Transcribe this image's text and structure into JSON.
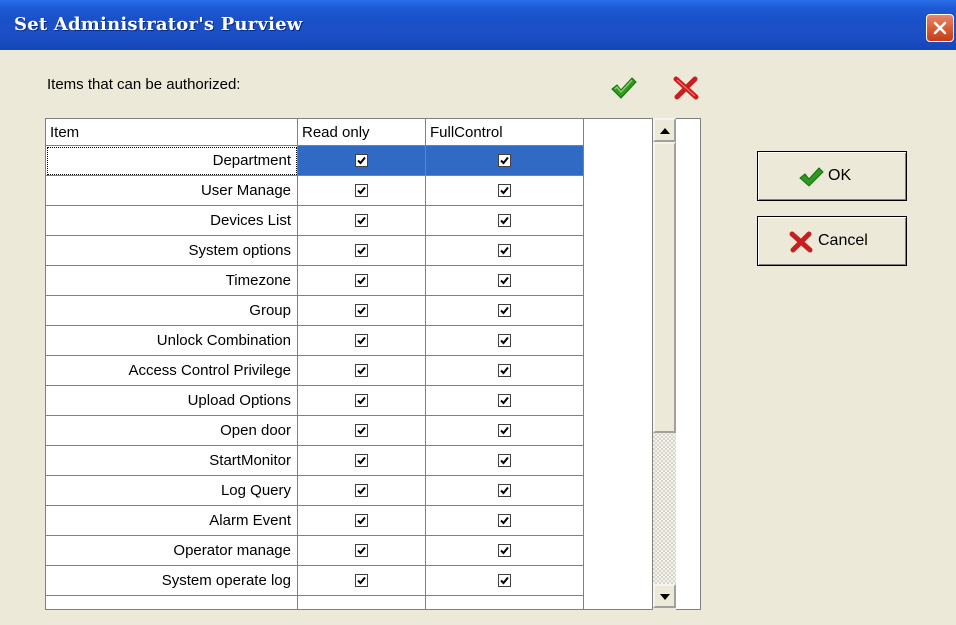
{
  "window": {
    "title": "Set Administrator's Purview"
  },
  "label": "Items that can be authorized:",
  "table": {
    "columns": [
      "Item",
      "Read only",
      "FullControl"
    ],
    "rows": [
      {
        "item": "Department",
        "read_only": true,
        "full_control": true
      },
      {
        "item": "User Manage",
        "read_only": true,
        "full_control": true
      },
      {
        "item": "Devices List",
        "read_only": true,
        "full_control": true
      },
      {
        "item": "System options",
        "read_only": true,
        "full_control": true
      },
      {
        "item": "Timezone",
        "read_only": true,
        "full_control": true
      },
      {
        "item": "Group",
        "read_only": true,
        "full_control": true
      },
      {
        "item": "Unlock Combination",
        "read_only": true,
        "full_control": true
      },
      {
        "item": "Access Control Privilege",
        "read_only": true,
        "full_control": true
      },
      {
        "item": "Upload Options",
        "read_only": true,
        "full_control": true
      },
      {
        "item": "Open door",
        "read_only": true,
        "full_control": true
      },
      {
        "item": "StartMonitor",
        "read_only": true,
        "full_control": true
      },
      {
        "item": "Log Query",
        "read_only": true,
        "full_control": true
      },
      {
        "item": "Alarm Event",
        "read_only": true,
        "full_control": true
      },
      {
        "item": "Operator manage",
        "read_only": true,
        "full_control": true
      },
      {
        "item": "System operate log",
        "read_only": true,
        "full_control": true
      }
    ],
    "selected_row": "Department"
  },
  "toolbar": {
    "check_all_icon": "green-check-icon",
    "uncheck_all_icon": "red-x-icon"
  },
  "buttons": {
    "ok": "OK",
    "cancel": "Cancel"
  },
  "colors": {
    "titlebar": "#1c4fc6",
    "selection": "#316ac5",
    "dialog_bg": "#ece9d8",
    "ok_check": "#2e9a1e",
    "cancel_x": "#c81e1e"
  }
}
